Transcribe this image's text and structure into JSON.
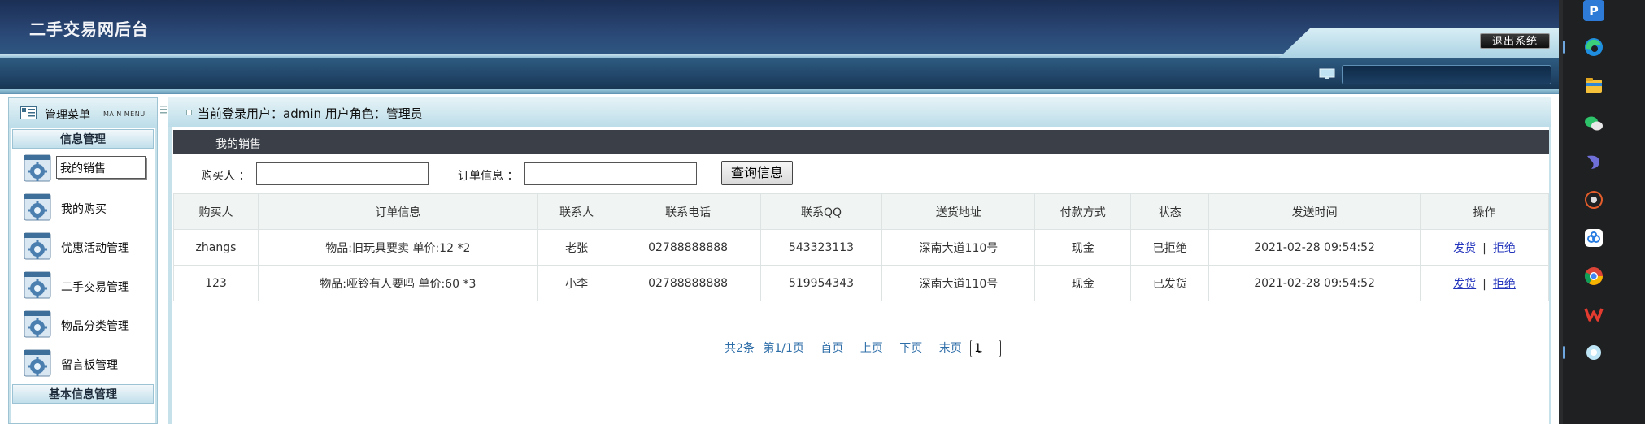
{
  "header": {
    "title": "二手交易网后台",
    "logout_label": "退出系统"
  },
  "sidebar": {
    "title": "管理菜单",
    "subtitle": "MAIN MENU",
    "groups": [
      {
        "label": "信息管理",
        "items": [
          {
            "label": "我的销售",
            "selected": true
          },
          {
            "label": "我的购买"
          },
          {
            "label": "优惠活动管理"
          },
          {
            "label": "二手交易管理"
          },
          {
            "label": "物品分类管理"
          },
          {
            "label": "留言板管理"
          }
        ]
      },
      {
        "label": "基本信息管理",
        "items": []
      }
    ]
  },
  "user_bar": {
    "text": "当前登录用户：admin  用户角色：管理员"
  },
  "panel": {
    "title": "我的销售"
  },
  "search": {
    "buyer_label": "购买人 ：",
    "order_label": "订单信息 ：",
    "buyer_value": "",
    "order_value": "",
    "button_label": "查询信息"
  },
  "table": {
    "headers": [
      "购买人",
      "订单信息",
      "联系人",
      "联系电话",
      "联系QQ",
      "送货地址",
      "付款方式",
      "状态",
      "发送时间",
      "操作"
    ],
    "rows": [
      {
        "cells": [
          "zhangs",
          "物品:旧玩具要卖 单价:12 *2",
          "老张",
          "02788888888",
          "543323113",
          "深南大道110号",
          "现金",
          "已拒绝",
          "2021-02-28 09:54:52"
        ],
        "actions": [
          "发货",
          "拒绝"
        ]
      },
      {
        "cells": [
          "123",
          "物品:哑铃有人要吗 单价:60 *3",
          "小李",
          "02788888888",
          "519954343",
          "深南大道110号",
          "现金",
          "已发货",
          "2021-02-28 09:54:52"
        ],
        "actions": [
          "发货",
          "拒绝"
        ]
      }
    ],
    "action_separator": "|"
  },
  "pagination": {
    "total": "共2条",
    "page_info": "第1/1页",
    "first": "首页",
    "prev": "上页",
    "next": "下页",
    "last": "末页",
    "selected_page": "1"
  },
  "taskbar": {
    "icons": [
      "p-app-icon",
      "edge-icon",
      "file-explorer-icon",
      "wechat-icon",
      "dolphin-app-icon",
      "settings-gear-icon",
      "baidu-netdisk-icon",
      "chrome-icon",
      "wps-icon",
      "cloud-app-icon"
    ]
  },
  "colors": {
    "header_dark": "#1b2f55",
    "sidebar_bg": "#c7e1ea",
    "panel_title_bg": "#3a3f48",
    "link": "#2233bb",
    "pagination": "#2e6ea8",
    "taskbar_bg": "#1f2021"
  }
}
